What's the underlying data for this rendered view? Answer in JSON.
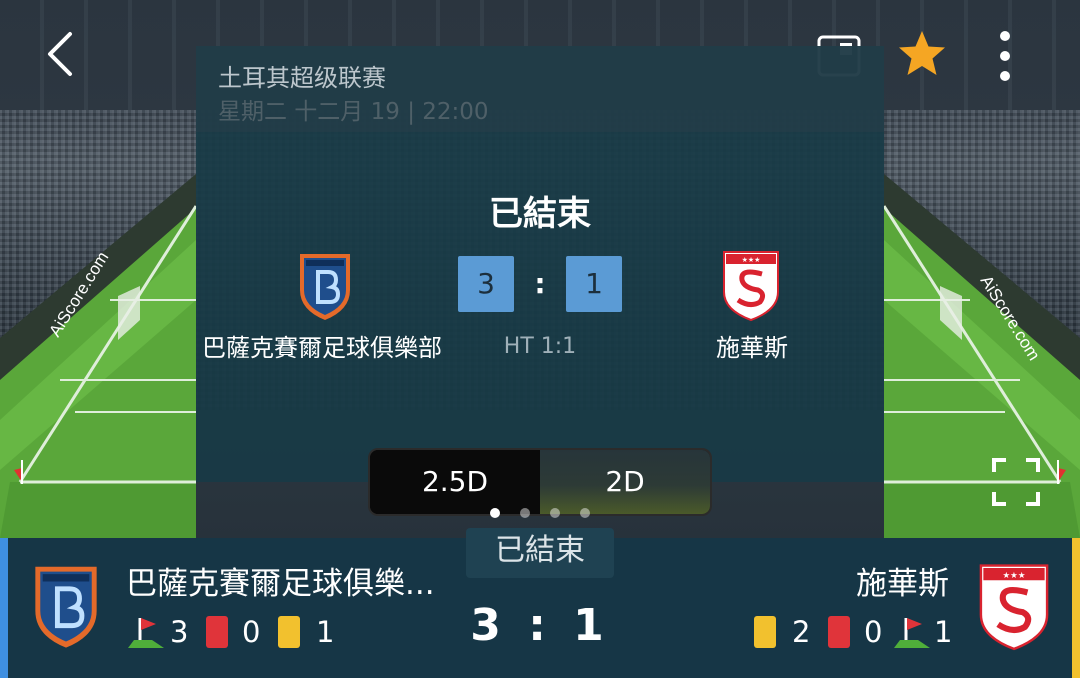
{
  "header": {
    "league": "土耳其超级联赛",
    "datetime": "星期二 十二月 19 | 22:00"
  },
  "match": {
    "status": "已結束",
    "home": {
      "name": "巴薩克賽爾足球俱樂部",
      "short_name": "巴薩克賽爾足球俱樂...",
      "score": "3"
    },
    "away": {
      "name": "施華斯",
      "score": "1"
    },
    "colon": ":",
    "halftime": "HT 1:1",
    "final_score": "3 : 1"
  },
  "view_toggle": {
    "option_25d": "2.5D",
    "option_2d": "2D",
    "selected": "2.5D"
  },
  "watermark": "AiScore.com",
  "stats": {
    "home": {
      "corners": "3",
      "red_cards": "0",
      "yellow_cards": "1"
    },
    "away": {
      "yellow_cards": "2",
      "red_cards": "0",
      "corners": "1"
    }
  },
  "colors": {
    "home_accent": "#3f8fe0",
    "away_accent": "#f2c12e",
    "score_box": "#5b9bd5",
    "star": "#f5a623"
  },
  "icons": [
    "back-icon",
    "mini-window-icon",
    "star-icon",
    "more-vert-icon",
    "fullscreen-icon",
    "corner-flag-icon",
    "red-card-icon",
    "yellow-card-icon"
  ]
}
